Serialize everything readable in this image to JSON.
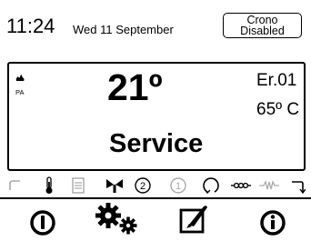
{
  "header": {
    "time": "11:24",
    "date": "Wed 11 September",
    "crono_line1": "Crono",
    "crono_line2": "Disabled"
  },
  "display": {
    "pa_label": "PA",
    "temperature": "21º",
    "error_code": "Er.01",
    "water_temp": "65º C",
    "mode": "Service"
  },
  "status_icons": [
    "return-arrow-icon",
    "thermometer-icon",
    "tank-icon",
    "fan-icon",
    "circle-2-icon",
    "circle-1-icon",
    "refresh-icon",
    "resistor-icon",
    "wave-icon",
    "turn-arrow-icon"
  ],
  "buttons": [
    "power-icon",
    "settings-gears-icon",
    "edit-pen-icon",
    "info-icon"
  ]
}
